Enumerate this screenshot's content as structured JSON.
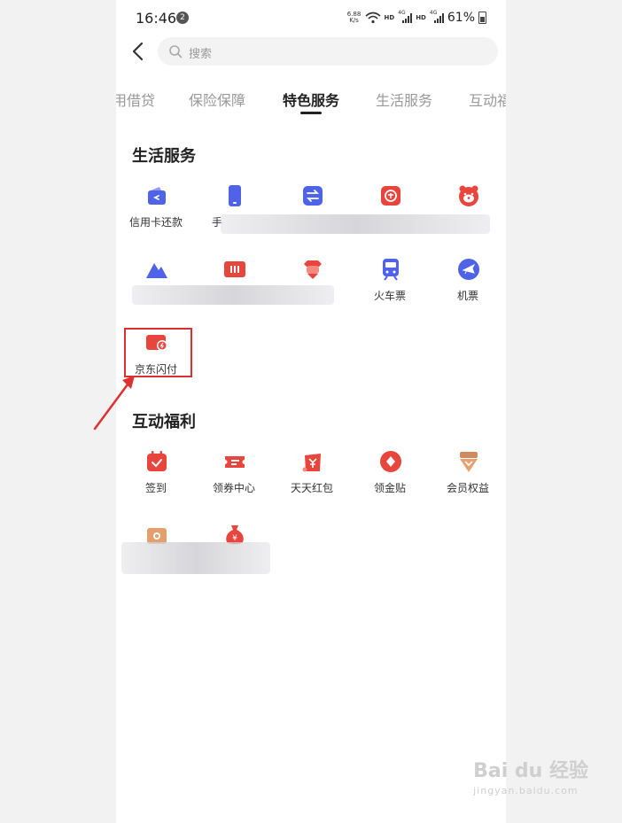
{
  "status_bar": {
    "time": "16:46",
    "notification_count": "2",
    "net_speed": "6.88",
    "net_unit": "K/s",
    "hd1": "HD",
    "hd2": "HD",
    "sig1": "4G",
    "sig2": "4G",
    "battery": "61%"
  },
  "search": {
    "placeholder": "搜索"
  },
  "tabs": [
    {
      "label": "用借贷"
    },
    {
      "label": "保险保障"
    },
    {
      "label": "特色服务",
      "active": true
    },
    {
      "label": "生活服务"
    },
    {
      "label": "互动福"
    }
  ],
  "life_services": {
    "title": "生活服务",
    "items": [
      {
        "label": "信用卡还款",
        "icon": "card-repay-icon"
      },
      {
        "label": "手",
        "icon": "phone-recharge-icon"
      },
      {
        "label": "",
        "icon": "transfer-icon"
      },
      {
        "label": "",
        "icon": "coin-icon"
      },
      {
        "label": "",
        "icon": "bear-icon"
      },
      {
        "label": "",
        "icon": "mountain-icon"
      },
      {
        "label": "",
        "icon": "ticket-icon"
      },
      {
        "label": "",
        "icon": "mascot-icon"
      },
      {
        "label": "火车票",
        "icon": "train-icon"
      },
      {
        "label": "机票",
        "icon": "plane-icon"
      },
      {
        "label": "京东闪付",
        "icon": "jd-quickpay-icon"
      }
    ]
  },
  "interactive_benefits": {
    "title": "互动福利",
    "items": [
      {
        "label": "签到",
        "icon": "calendar-check-icon"
      },
      {
        "label": "领券中心",
        "icon": "coupon-icon"
      },
      {
        "label": "天天红包",
        "icon": "red-packet-icon"
      },
      {
        "label": "领金贴",
        "icon": "gold-icon"
      },
      {
        "label": "会员权益",
        "icon": "member-icon"
      },
      {
        "label": "",
        "icon": "wallet-icon"
      },
      {
        "label": "",
        "icon": "money-bag-icon"
      }
    ]
  },
  "watermark": {
    "brand": "Bai du 经验",
    "sub": "jingyan.baidu.com"
  },
  "colors": {
    "blue": "#4e63e8",
    "red": "#e8453c",
    "highlight": "#d93030"
  }
}
